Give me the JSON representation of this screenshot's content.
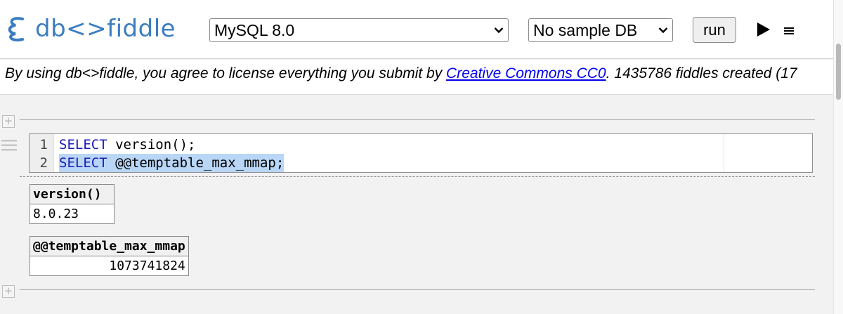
{
  "app": {
    "logo_text": "db<>fiddle",
    "brand_color": "#3b7dc0"
  },
  "toolbar": {
    "db_select_value": "MySQL 8.0",
    "sample_select_value": "No sample DB",
    "run_label": "run",
    "play_icon": "play-icon",
    "menu_icon": "hamburger-menu-icon"
  },
  "license": {
    "prefix": "By using db<>fiddle, you agree to license everything you submit by ",
    "link_text": "Creative Commons CC0",
    "suffix": ". 1435786 fiddles created (17"
  },
  "editor": {
    "lines": [
      {
        "number": "1",
        "keyword": "SELECT",
        "rest": " version();"
      },
      {
        "number": "2",
        "keyword": "SELECT",
        "rest": " @@temptable_max_mmap;"
      }
    ]
  },
  "results": [
    {
      "header": "version()",
      "value": "8.0.23"
    },
    {
      "header": "@@temptable_max_mmap",
      "value": "1073741824"
    }
  ],
  "colors": {
    "keyword": "#1a1ab8",
    "selection": "#b9d6f7",
    "link": "#0000ee"
  }
}
